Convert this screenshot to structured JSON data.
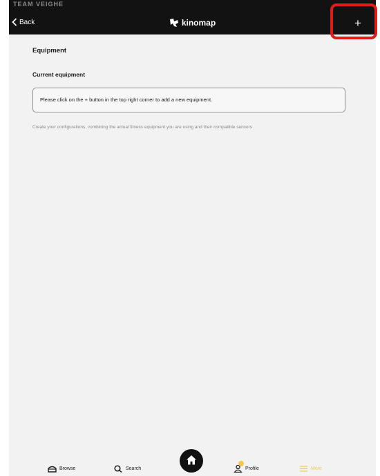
{
  "status_bar": {
    "text": "TEAM VEIGHE"
  },
  "nav": {
    "back_label": "Back",
    "logo_text": "kinomap",
    "add_label": "+"
  },
  "page": {
    "title": "Equipment",
    "current_equipment_label": "Current equipment",
    "empty_message": "Please click on the + button in the top right corner to add a new equipment.",
    "help_text": "Create your configurations, combining the actual fitness equipment you are using and their compatible sensors"
  },
  "tabs": [
    {
      "label": "Browse",
      "icon": "browse-icon"
    },
    {
      "label": "Search",
      "icon": "search-icon"
    },
    {
      "label": "",
      "icon": "home-icon"
    },
    {
      "label": "Profile",
      "icon": "profile-icon"
    },
    {
      "label": "More",
      "icon": "menu-icon",
      "active": true
    }
  ],
  "colors": {
    "bar_background": "#121212",
    "page_background": "#f2f2f2",
    "accent": "#f2c94c",
    "highlight": "#e11b1b"
  }
}
